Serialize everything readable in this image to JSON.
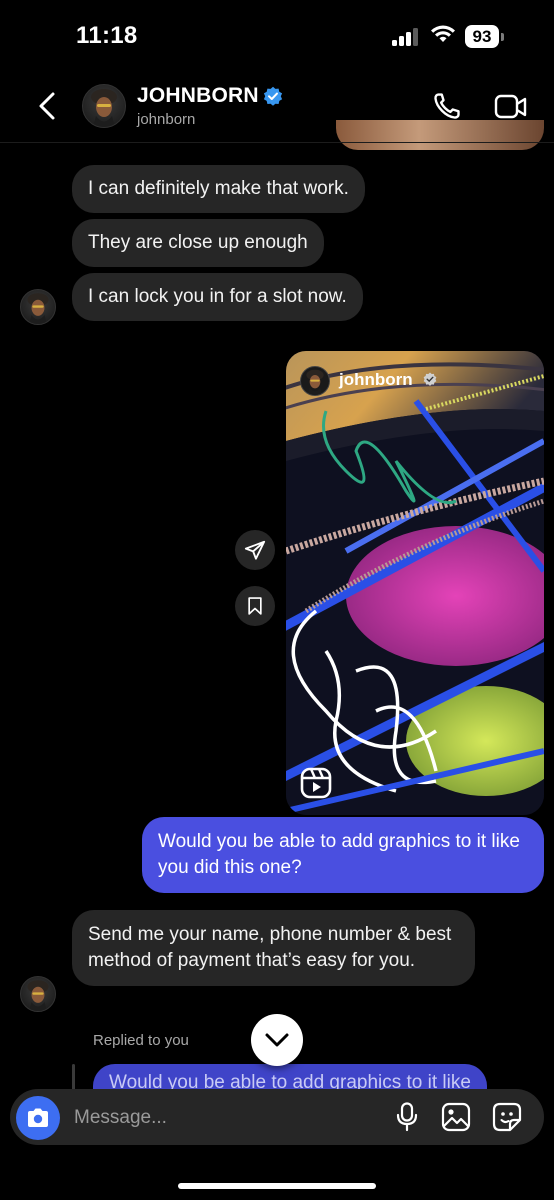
{
  "status_bar": {
    "time": "11:18",
    "battery": "93"
  },
  "header": {
    "name": "JOHNBORN",
    "handle": "johnborn"
  },
  "messages": {
    "in1": "I can definitely make that work.",
    "in2": "They are close up enough",
    "in3": "I can lock you in for a slot now.",
    "reel_user": "johnborn",
    "out1": "Would you be able to add graphics to it like you did this one?",
    "in4": "Send me your name, phone number & best method of payment that’s easy for you.",
    "replied_label": "Replied to you",
    "reply_preview": "Would you be able to add graphics to it like"
  },
  "composer": {
    "placeholder": "Message..."
  },
  "icons": {
    "back": "chevron-left-icon",
    "verified": "verified-badge-icon",
    "call": "phone-icon",
    "video": "video-camera-icon",
    "share": "paper-plane-icon",
    "save": "bookmark-icon",
    "reels": "reels-icon",
    "scroll": "chevron-down-icon",
    "camera": "camera-icon",
    "mic": "microphone-icon",
    "gallery": "image-icon",
    "sticker": "sticker-icon"
  },
  "colors": {
    "outgoing_bubble": "#4a4fe0",
    "incoming_bubble": "#262626",
    "camera_button": "#3d6ef2",
    "verified": "#3897f0"
  }
}
